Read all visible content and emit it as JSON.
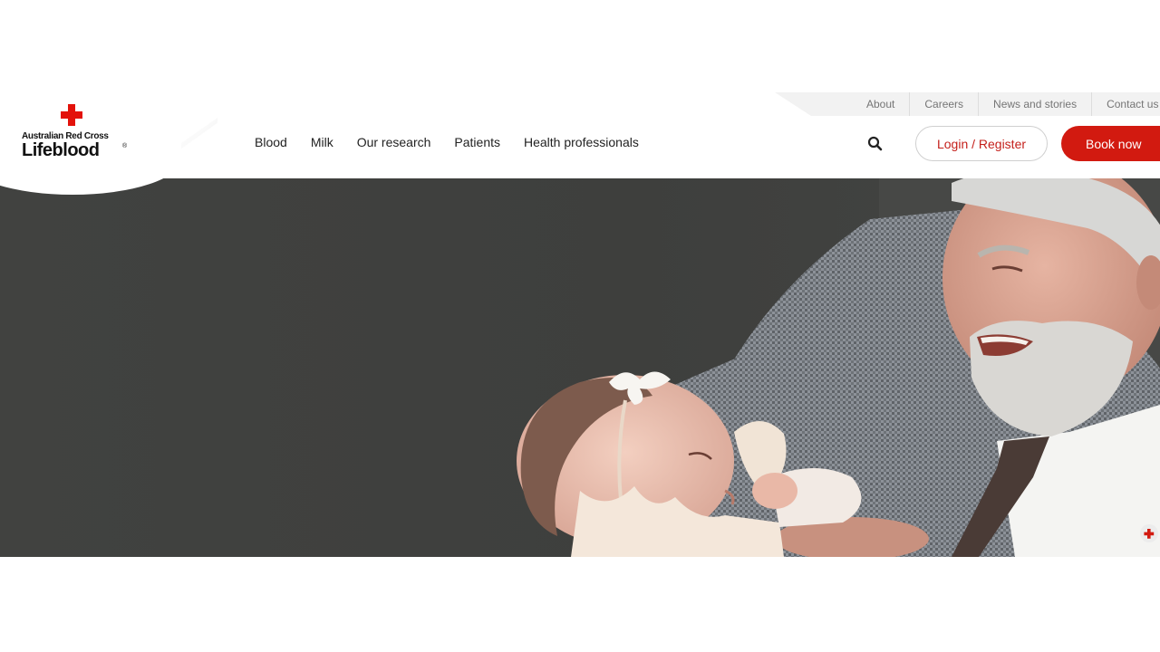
{
  "brand": {
    "subtitle": "Australian Red Cross",
    "name": "Lifeblood",
    "registered_mark": "®",
    "accent_color": "#d21a10",
    "cross_color": "#e3120b"
  },
  "utility_nav": {
    "items": [
      {
        "label": "About"
      },
      {
        "label": "Careers"
      },
      {
        "label": "News and stories"
      },
      {
        "label": "Contact us"
      }
    ]
  },
  "main_nav": {
    "items": [
      {
        "label": "Blood"
      },
      {
        "label": "Milk"
      },
      {
        "label": "Our research"
      },
      {
        "label": "Patients"
      },
      {
        "label": "Health professionals"
      }
    ]
  },
  "header_actions": {
    "search_icon": "search-icon",
    "login_label": "Login / Register",
    "book_label": "Book now"
  },
  "hero": {
    "image_subject": "elderly man holding a baby"
  }
}
